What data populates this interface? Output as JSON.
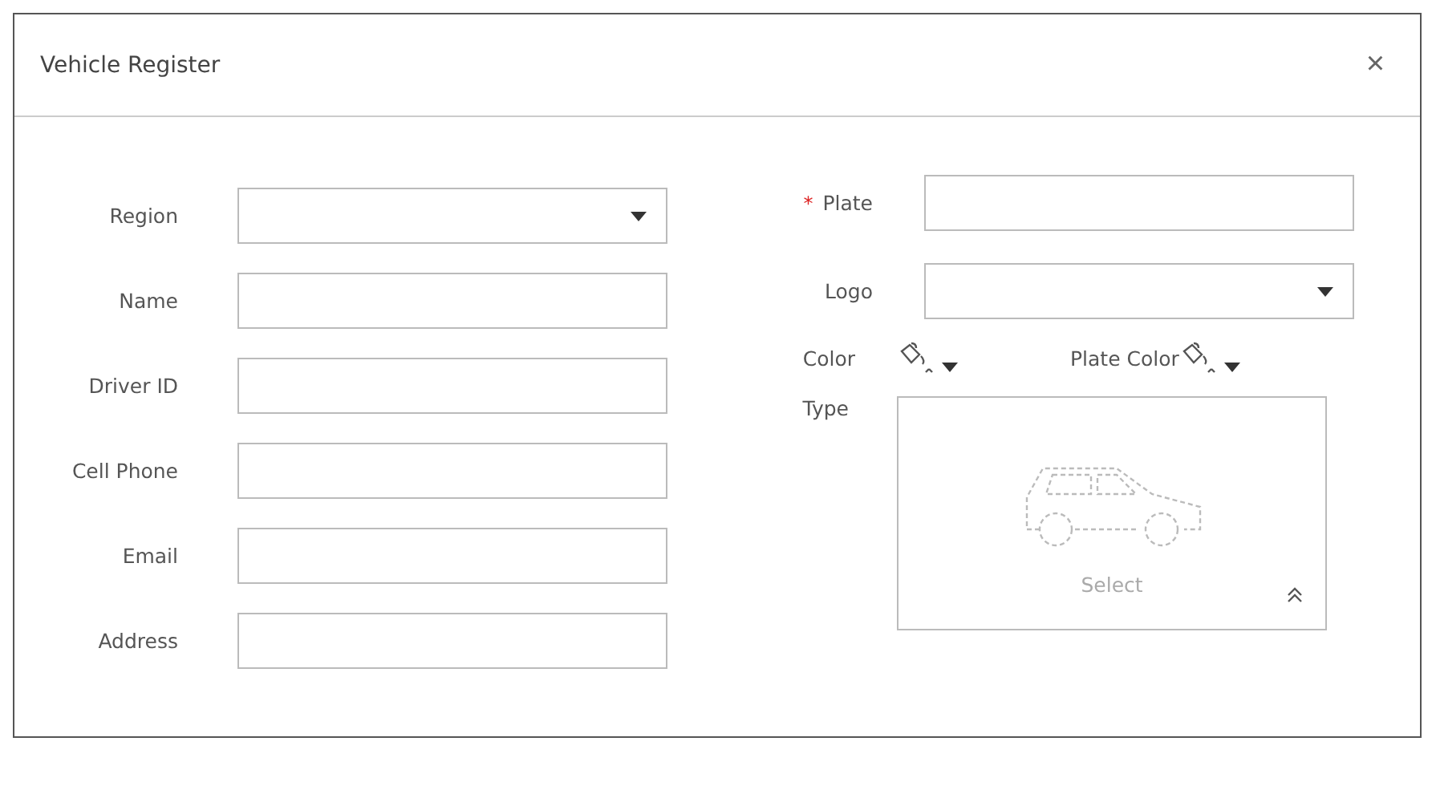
{
  "window": {
    "title": "Vehicle Register",
    "close": "×"
  },
  "left_fields": [
    {
      "label": "Region",
      "kind": "select"
    },
    {
      "label": "Name",
      "kind": "text"
    },
    {
      "label": "Driver ID",
      "kind": "text"
    },
    {
      "label": "Cell Phone",
      "kind": "text"
    },
    {
      "label": "Email",
      "kind": "text"
    },
    {
      "label": "Address",
      "kind": "text"
    }
  ],
  "right_fields": [
    {
      "label": "Plate",
      "kind": "text",
      "required_mark": "*"
    },
    {
      "label": "Logo",
      "kind": "select"
    }
  ],
  "color_row": {
    "label": "Color",
    "plate_color_label": "Plate Color"
  },
  "type": {
    "label": "Type",
    "button": "Select"
  }
}
